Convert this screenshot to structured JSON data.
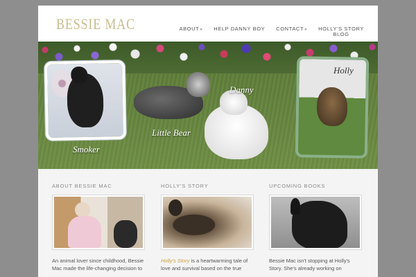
{
  "site": {
    "logo": "BESSIE MAC"
  },
  "nav": {
    "items": [
      {
        "label": "ABOUT",
        "has_submenu": true
      },
      {
        "label": "HELP DANNY BOY",
        "has_submenu": false
      },
      {
        "label": "CONTACT",
        "has_submenu": true
      },
      {
        "label": "HOLLY'S STORY",
        "label2": "BLOG",
        "has_submenu": false
      }
    ],
    "submenu_glyph": "»"
  },
  "banner": {
    "labels": {
      "smoker": "Smoker",
      "little_bear": "Little Bear",
      "danny": "Danny",
      "holly": "Holly"
    }
  },
  "columns": [
    {
      "title": "ABOUT BESSIE MAC",
      "text": "An animal lover since childhood, Bessie Mac made the life-changing decision to"
    },
    {
      "title": "HOLLY'S STORY",
      "link": "Holly's Story",
      "text": " is a heartwarming tale of love and survival based on the true"
    },
    {
      "title": "UPCOMING BOOKS",
      "text": "Bessie Mac isn't stopping at Holly's Story. She's already working on"
    }
  ],
  "colors": {
    "logo": "#c8bd8e",
    "link_accent": "#c9a23a",
    "page_background": "#8e8e8e"
  }
}
